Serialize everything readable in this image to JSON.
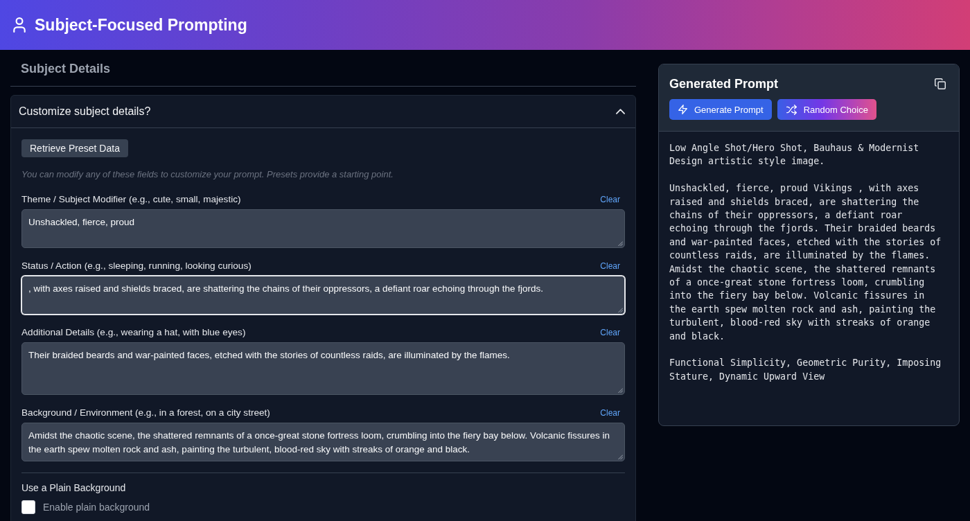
{
  "header": {
    "title": "Subject-Focused Prompting"
  },
  "subject_details": {
    "heading": "Subject Details",
    "accordion": {
      "title": "Customize subject details?",
      "expanded": true
    },
    "preset_button": "Retrieve Preset Data",
    "hint": "You can modify any of these fields to customize your prompt. Presets provide a starting point.",
    "fields": [
      {
        "label": "Theme / Subject Modifier (e.g., cute, small, majestic)",
        "clear": "Clear",
        "value": "Unshackled, fierce, proud",
        "focused": false
      },
      {
        "label": "Status / Action (e.g., sleeping, running, looking curious)",
        "clear": "Clear",
        "value": ", with axes raised and shields braced, are shattering the chains of their oppressors, a defiant roar echoing through the fjords.",
        "focused": true
      },
      {
        "label": "Additional Details (e.g., wearing a hat, with blue eyes)",
        "clear": "Clear",
        "value": "Their braided beards and war-painted faces, etched with the stories of countless raids, are illuminated by the flames.",
        "focused": false
      },
      {
        "label": "Background / Environment (e.g., in a forest, on a city street)",
        "clear": "Clear",
        "value": "Amidst the chaotic scene, the shattered remnants of a once-great stone fortress loom, crumbling into the fiery bay below. Volcanic fissures in the earth spew molten rock and ash, painting the turbulent, blood-red sky with streaks of orange and black.",
        "focused": false
      }
    ],
    "plain_background": {
      "label": "Use a Plain Background",
      "checkbox_label": "Enable plain background",
      "checked": false
    }
  },
  "generated_prompt": {
    "title": "Generated Prompt",
    "buttons": [
      {
        "label": "Generate Prompt",
        "kind": "primary"
      },
      {
        "label": "Random Choice",
        "kind": "random"
      }
    ],
    "paragraphs": [
      "Low Angle Shot/Hero Shot, Bauhaus & Modernist Design artistic style image.",
      "Unshackled, fierce, proud Vikings , with axes raised and shields braced, are shattering the chains of their oppressors, a defiant roar echoing through the fjords. Their braided beards and war-painted faces, etched with the stories of countless raids, are illuminated by the flames. Amidst the chaotic scene, the shattered remnants of a once-great stone fortress loom, crumbling into the fiery bay below. Volcanic fissures in the earth spew molten rock and ash, painting the turbulent, blood-red sky with streaks of orange and black.",
      "Functional Simplicity, Geometric Purity, Imposing Stature, Dynamic Upward View"
    ]
  }
}
